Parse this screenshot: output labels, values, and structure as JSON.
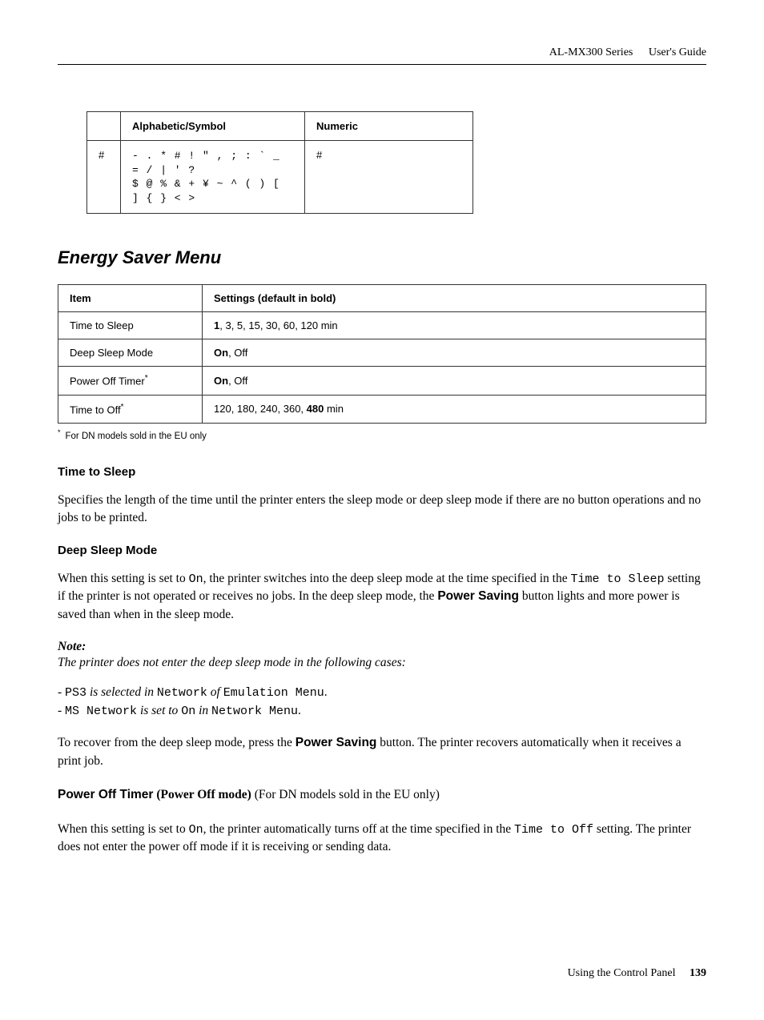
{
  "header": {
    "product": "AL-MX300 Series",
    "doc": "User's Guide"
  },
  "table1": {
    "head": {
      "c2": "Alphabetic/Symbol",
      "c3": "Numeric"
    },
    "row": {
      "c1": "#",
      "c2a": "- . * # ! \" , ; : ` _ = / | ' ?",
      "c2b": "$ @ % & + ¥ ~ ^ ( ) [ ] { } < >",
      "c3": "#"
    }
  },
  "section_title": "Energy Saver Menu",
  "table2": {
    "head": {
      "c1": "Item",
      "c2": "Settings (default in bold)"
    },
    "rows": [
      {
        "c1": "Time to Sleep",
        "c2_pre_b": "1",
        "c2_rest": ", 3, 5, 15, 30, 60, 120 min"
      },
      {
        "c1": "Deep Sleep Mode",
        "c2_pre_b": "On",
        "c2_rest": ", Off"
      },
      {
        "c1_text": "Power Off Timer",
        "c1_sup": "*",
        "c2_pre_b": "On",
        "c2_rest": ", Off"
      },
      {
        "c1_text": "Time to Off",
        "c1_sup": "*",
        "c2_pre": "120, 180, 240, 360, ",
        "c2_b": "480",
        "c2_post": " min"
      }
    ]
  },
  "footnote": {
    "star": "*",
    "text": "For DN models sold in the EU only"
  },
  "tts": {
    "h": "Time to Sleep",
    "p": "Specifies the length of the time until the printer enters the sleep mode or deep sleep mode if there are no button operations and no jobs to be printed."
  },
  "dsm": {
    "h": "Deep Sleep Mode",
    "p1_a": "When this setting is set to ",
    "p1_code1": "On",
    "p1_b": ", the printer switches into the deep sleep mode at the time specified in the ",
    "p1_code2": "Time to Sleep",
    "p1_c": " setting if the printer is not operated or receives no jobs. In the deep sleep mode, the ",
    "p1_bold": "Power Saving",
    "p1_d": " button lights and more power is saved than when in the sleep mode."
  },
  "note": {
    "label": "Note:",
    "lead": "The printer does not enter the deep sleep mode in the following cases:",
    "l1": {
      "a": "- ",
      "c1": "PS3",
      "b": " is selected in ",
      "c2": "Network",
      "c": " of ",
      "c3": "Emulation Menu",
      "d": "."
    },
    "l2": {
      "a": "- ",
      "c1": "MS Network",
      "b": " is set to ",
      "c2": "On",
      "c": " in ",
      "c3": "Network Menu",
      "d": "."
    }
  },
  "recover": {
    "a": "To recover from the deep sleep mode, press the ",
    "b": "Power Saving",
    "c": " button. The printer recovers automatically when it receives a print job."
  },
  "pot": {
    "h_bold": "Power Off Timer",
    "h_paren_b": " (Power Off mode)",
    "h_rest": " (For DN models sold in the EU only)",
    "p_a": "When this setting is set to ",
    "p_c1": "On",
    "p_b": ", the printer automatically turns off at the time specified in the ",
    "p_c2": "Time to Off",
    "p_c": " setting. The printer does not enter the power off mode if it is receiving or sending data."
  },
  "footer": {
    "text": "Using the Control Panel",
    "page": "139"
  }
}
